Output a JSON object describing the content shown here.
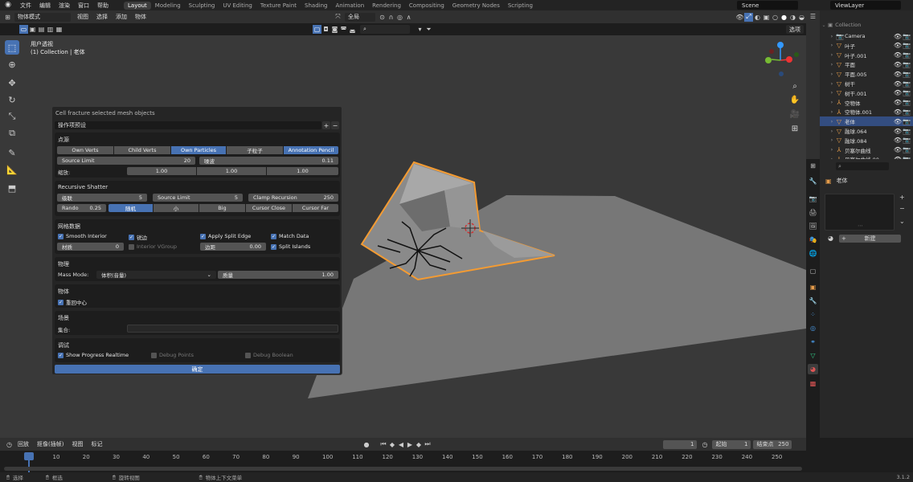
{
  "topbar": {
    "menus": [
      "文件",
      "编辑",
      "渲染",
      "窗口",
      "帮助"
    ],
    "workspaces": [
      "Layout",
      "Modeling",
      "Sculpting",
      "UV Editing",
      "Texture Paint",
      "Shading",
      "Animation",
      "Rendering",
      "Compositing",
      "Geometry Nodes",
      "Scripting"
    ],
    "active_workspace": "Layout",
    "scene": "Scene",
    "view_layer": "ViewLayer"
  },
  "viewport_header": {
    "mode": "物体模式",
    "menus": [
      "视图",
      "选择",
      "添加",
      "物体"
    ],
    "transform": "全局",
    "options": "选项"
  },
  "viewport": {
    "view_name": "用户透视",
    "collection": "(1) Collection | 老体"
  },
  "panel": {
    "title": "Cell fracture selected mesh objects",
    "preset": "操作项预设",
    "source": {
      "title": "点源",
      "buttons": [
        "Own Verts",
        "Child Verts",
        "Own Particles",
        "子粒子",
        "Annotation Pencil"
      ],
      "source_limit_label": "Source Limit",
      "source_limit": "20",
      "noise_label": "噪波",
      "noise": "0.11",
      "scale_label": "缩放:",
      "scale": [
        "1.00",
        "1.00",
        "1.00"
      ]
    },
    "recursive": {
      "title": "Recursive Shatter",
      "level_label": "级联",
      "level": "5",
      "source_limit_label": "Source Limit",
      "source_limit": "5",
      "clamp_label": "Clamp Recursion",
      "clamp": "250",
      "rando_label": "Rando",
      "rando": "0.25",
      "buttons": [
        "随机",
        "小",
        "Big",
        "Cursor Close",
        "Cursor Far"
      ]
    },
    "mesh": {
      "title": "网格数据",
      "smooth_interior": "Smooth Interior",
      "sharp_edges": "锐边",
      "apply_split_edge": "Apply Split Edge",
      "match_data": "Match Data",
      "material_label": "材质",
      "material": "0",
      "interior_vgroup": "Interior VGroup",
      "margin_label": "边距",
      "margin": "0.00",
      "split_islands": "Split Islands"
    },
    "physics": {
      "title": "物理",
      "mass_mode_label": "Mass Mode:",
      "mass_mode": "体积(音量)",
      "mass_label": "质量",
      "mass": "1.00"
    },
    "object": {
      "title": "物体",
      "recenter": "重回中心"
    },
    "scene": {
      "title": "场景",
      "collection_label": "集合:"
    },
    "debug": {
      "title": "调试",
      "show_progress": "Show Progress Realtime",
      "debug_points": "Debug Points",
      "debug_boolean": "Debug Boolean"
    },
    "ok": "确定"
  },
  "outliner": {
    "items": [
      {
        "name": "Camera",
        "type": "camera"
      },
      {
        "name": "叶子",
        "type": "mesh"
      },
      {
        "name": "叶子.001",
        "type": "mesh"
      },
      {
        "name": "平面",
        "type": "mesh"
      },
      {
        "name": "平面.005",
        "type": "mesh"
      },
      {
        "name": "树干",
        "type": "mesh"
      },
      {
        "name": "树干.001",
        "type": "mesh"
      },
      {
        "name": "空物体",
        "type": "empty"
      },
      {
        "name": "空物体.001",
        "type": "empty"
      },
      {
        "name": "老体",
        "type": "mesh",
        "selected": true
      },
      {
        "name": "融球.064",
        "type": "meta"
      },
      {
        "name": "融球.084",
        "type": "meta"
      },
      {
        "name": "贝塞尔曲线",
        "type": "curve"
      },
      {
        "name": "贝塞尔曲线.00",
        "type": "curve"
      }
    ]
  },
  "properties": {
    "object_name": "老体",
    "new_label": "新建"
  },
  "timeline": {
    "menus": [
      "回放",
      "抠像(插帧)",
      "视图",
      "标记"
    ],
    "current_frame": "1",
    "start_label": "起始",
    "start": "1",
    "end_label": "结束点",
    "end": "250",
    "ticks": [
      "1",
      "10",
      "20",
      "30",
      "40",
      "50",
      "60",
      "70",
      "80",
      "90",
      "100",
      "110",
      "120",
      "130",
      "140",
      "150",
      "160",
      "170",
      "180",
      "190",
      "200",
      "210",
      "220",
      "230",
      "240",
      "250"
    ]
  },
  "statusbar": {
    "select": "选择",
    "box_select": "框选",
    "rotate_view": "旋转视图",
    "context_menu": "物体上下文菜单",
    "version": "3.1.2"
  }
}
